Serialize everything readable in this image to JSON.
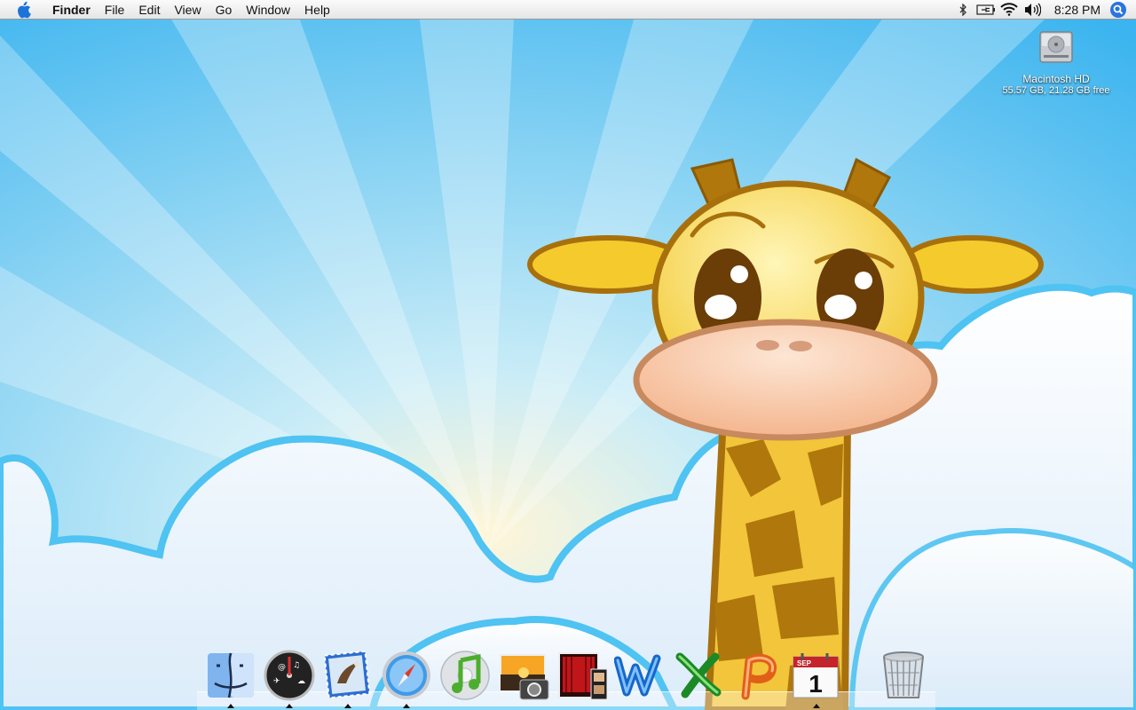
{
  "menubar": {
    "apple_icon": "apple-icon",
    "app_name": "Finder",
    "menus": [
      "File",
      "Edit",
      "View",
      "Go",
      "Window",
      "Help"
    ],
    "status_icons": [
      "bluetooth-icon",
      "battery-icon",
      "wifi-icon",
      "volume-icon"
    ],
    "clock": "8:28 PM",
    "spotlight_icon": "spotlight-icon"
  },
  "desktop": {
    "drive": {
      "icon": "hard-drive-icon",
      "name": "Macintosh HD",
      "info": "55.57 GB, 21.28 GB free"
    }
  },
  "dock": {
    "items": [
      {
        "icon": "finder-icon",
        "running": true
      },
      {
        "icon": "dashboard-icon",
        "running": true
      },
      {
        "icon": "mail-icon",
        "running": true
      },
      {
        "icon": "safari-icon",
        "running": true
      },
      {
        "icon": "itunes-icon",
        "running": false
      },
      {
        "icon": "iphoto-icon",
        "running": false
      },
      {
        "icon": "front-row-icon",
        "running": false
      },
      {
        "icon": "word-icon",
        "running": false
      },
      {
        "icon": "excel-icon",
        "running": false
      },
      {
        "icon": "powerpoint-icon",
        "running": false
      },
      {
        "icon": "ical-icon",
        "running": true,
        "month": "SEP",
        "day": "1"
      },
      {
        "icon": "trash-icon",
        "running": false
      }
    ]
  }
}
